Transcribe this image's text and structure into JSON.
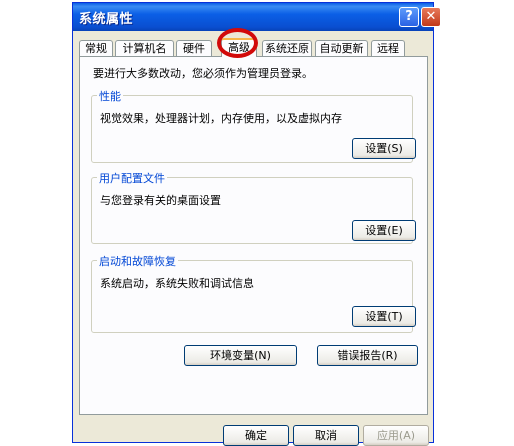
{
  "window": {
    "title": "系统属性",
    "help_label": "?",
    "close_label": "✕"
  },
  "tabs": [
    {
      "label": "常规"
    },
    {
      "label": "计算机名"
    },
    {
      "label": "硬件"
    },
    {
      "label": "高级"
    },
    {
      "label": "系统还原"
    },
    {
      "label": "自动更新"
    },
    {
      "label": "远程"
    }
  ],
  "active_tab": "高级",
  "note": "要进行大多数改动，您必须作为管理员登录。",
  "groups": [
    {
      "title": "性能",
      "description": "视觉效果，处理器计划，内存使用，以及虚拟内存",
      "button": "设置(S)"
    },
    {
      "title": "用户配置文件",
      "description": "与您登录有关的桌面设置",
      "button": "设置(E)"
    },
    {
      "title": "启动和故障恢复",
      "description": "系统启动，系统失败和调试信息",
      "button": "设置(T)"
    }
  ],
  "env_button": "环境变量(N)",
  "error_button": "错误报告(R)",
  "footer": {
    "ok": "确定",
    "cancel": "取消",
    "apply": "应用(A)"
  },
  "colors": {
    "title_bar": "#0a5de5",
    "close_button": "#c1391a",
    "highlight_circle": "#d20a0a",
    "group_title": "#0046d5"
  }
}
